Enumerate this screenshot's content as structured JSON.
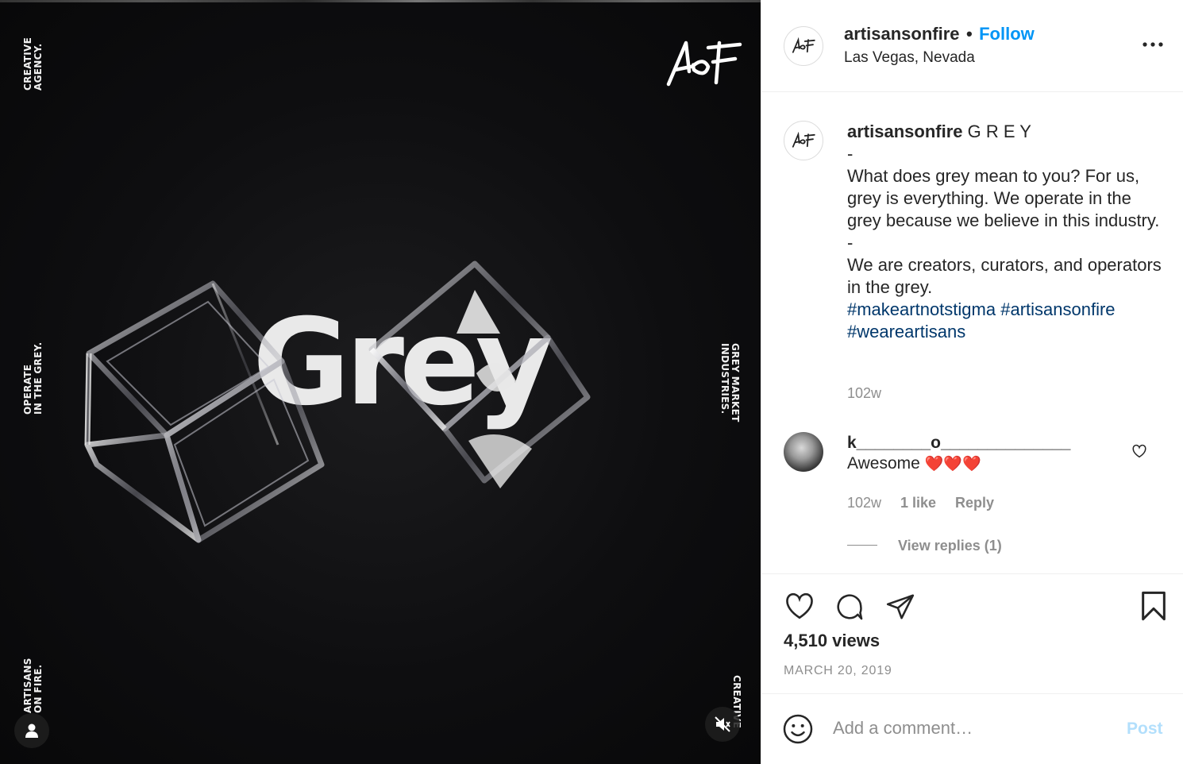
{
  "media": {
    "logo_text": "AoF",
    "big_word": "Grey",
    "left_top_text": "CREATIVE\nAGENCY.",
    "left_mid_text": "OPERATE\nIN THE GREY.",
    "left_bottom_text": "ARTISANS\nON FIRE.",
    "right_mid_text": "GREY MARKET\nINDUSTRIES.",
    "right_bottom_text": "CREATIVE",
    "icons": [
      "user-tag-icon",
      "muted-speaker-icon"
    ]
  },
  "header": {
    "username": "artisansonfire",
    "separator": "•",
    "follow_label": "Follow",
    "location": "Las Vegas, Nevada",
    "more_icon": "ellipsis-icon"
  },
  "caption": {
    "username": "artisansonfire",
    "title": "G R E Y",
    "dash1": "-",
    "paragraph1": "What does grey mean to you? For us, grey is everything. We operate in the grey because we believe in this industry.",
    "dash2": "-",
    "paragraph2": "We are creators, curators, and operators in the grey.",
    "hashtag1": "#makeartnotstigma",
    "hashtag2": "#artisansonfire",
    "hashtag3": "#weareartisans",
    "age": "102w"
  },
  "comment": {
    "username": "k________o______________",
    "text": "Awesome",
    "emoji": "❤️❤️❤️",
    "age": "102w",
    "likes": "1 like",
    "reply_label": "Reply",
    "view_replies": "View replies (1)"
  },
  "actions": {
    "icons": [
      "heart-icon",
      "comment-icon",
      "share-icon",
      "bookmark-icon"
    ],
    "views": "4,510 views",
    "date": "MARCH 20, 2019"
  },
  "add_comment": {
    "placeholder": "Add a comment…",
    "post_label": "Post",
    "emoji_icon": "smiley-icon"
  }
}
